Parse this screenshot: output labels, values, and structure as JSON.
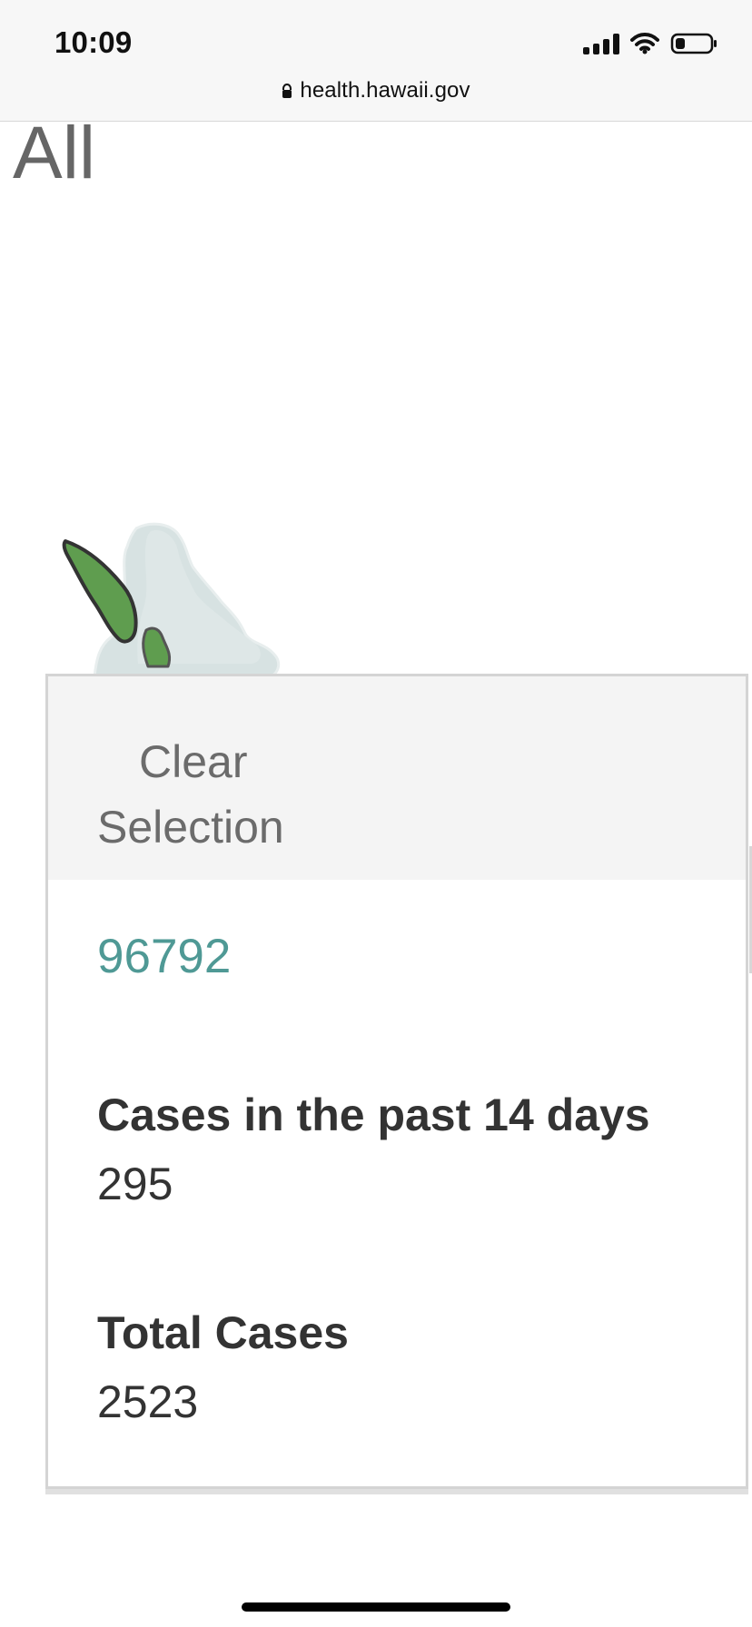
{
  "status_bar": {
    "time": "10:09",
    "signal_icon": "cellular-signal",
    "wifi_icon": "wifi",
    "battery_icon": "battery"
  },
  "browser": {
    "lock_icon": "lock",
    "url": "health.hawaii.gov"
  },
  "page": {
    "view_label": "All"
  },
  "map": {
    "region": "Oahu",
    "selected_region_color": "#5f9d4f",
    "base_region_color": "#d7e2e2"
  },
  "popup": {
    "clear_selection_label": "Clear Selection",
    "zip_code": "96792",
    "metrics": [
      {
        "label": "Cases in the past 14 days",
        "value": "295"
      },
      {
        "label": "Total Cases",
        "value": "2523"
      }
    ]
  }
}
